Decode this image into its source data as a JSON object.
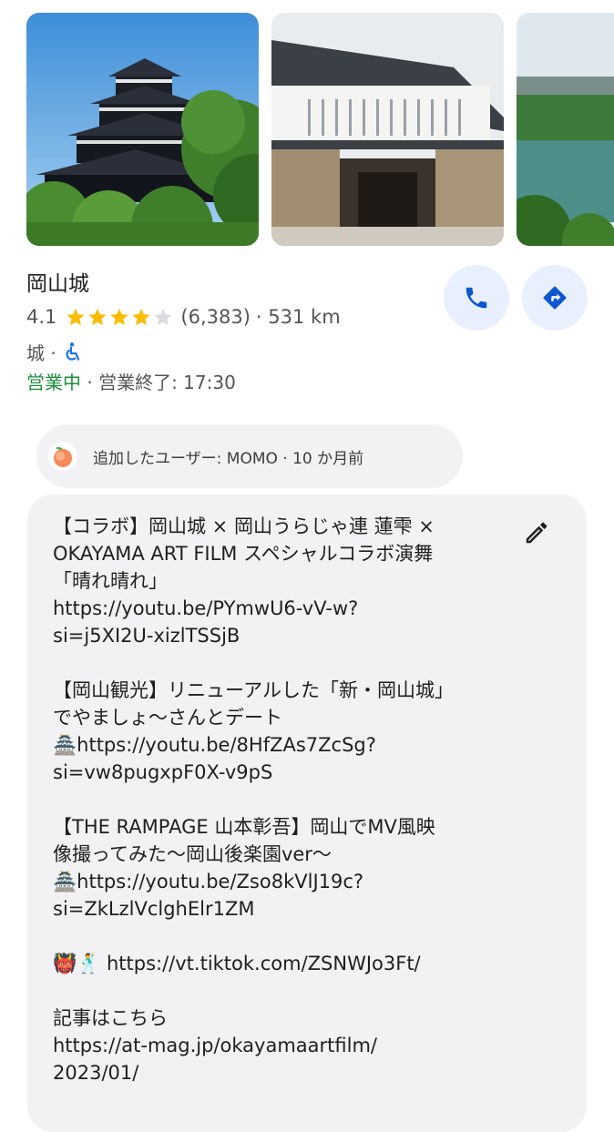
{
  "photos": [
    {
      "name": "castle-main-photo"
    },
    {
      "name": "castle-gate-photo"
    },
    {
      "name": "castle-river-photo"
    }
  ],
  "place": {
    "name": "岡山城",
    "rating": "4.1",
    "stars_value": 4.1,
    "stars_max": 5,
    "reviews": "(6,383)",
    "distance": "· 531 km",
    "category": "城 ·",
    "open_status": "営業中",
    "closing": " · 営業終了: 17:30"
  },
  "actions": {
    "call_icon": "phone-icon",
    "directions_icon": "directions-icon",
    "accent": "#0b57d0",
    "button_bg": "#e8f0fe"
  },
  "added_by": {
    "avatar_icon": "peach-icon",
    "text": "追加したユーザー: MOMO · 10 か月前"
  },
  "description": {
    "lines": [
      "【コラボ】岡山城 × 岡山うらじゃ連 蓮雫 ×",
      "OKAYAMA ART FILM スペシャルコラボ演舞",
      "「晴れ晴れ」",
      "https://youtu.be/PYmwU6-vV-w?",
      "si=j5XI2U-xizlTSSjB",
      "",
      "【岡山観光】リニューアルした「新・岡山城」",
      "でやましょ〜さんとデート",
      "🏯https://youtu.be/8HfZAs7ZcSg?",
      "si=vw8pugxpF0X-v9pS",
      "",
      "【THE RAMPAGE 山本彰吾】岡山でMV風映",
      "像撮ってみた〜岡山後楽園ver〜",
      "🏯https://youtu.be/Zso8kVlJ19c?",
      "si=ZkLzlVclghElr1ZM",
      "",
      "👹🕺 https://vt.tiktok.com/ZSNWJo3Ft/",
      "",
      "記事はこちら",
      "https://at-mag.jp/okayamaartfilm/",
      "2023/01/"
    ],
    "edit_icon": "pencil-icon"
  }
}
